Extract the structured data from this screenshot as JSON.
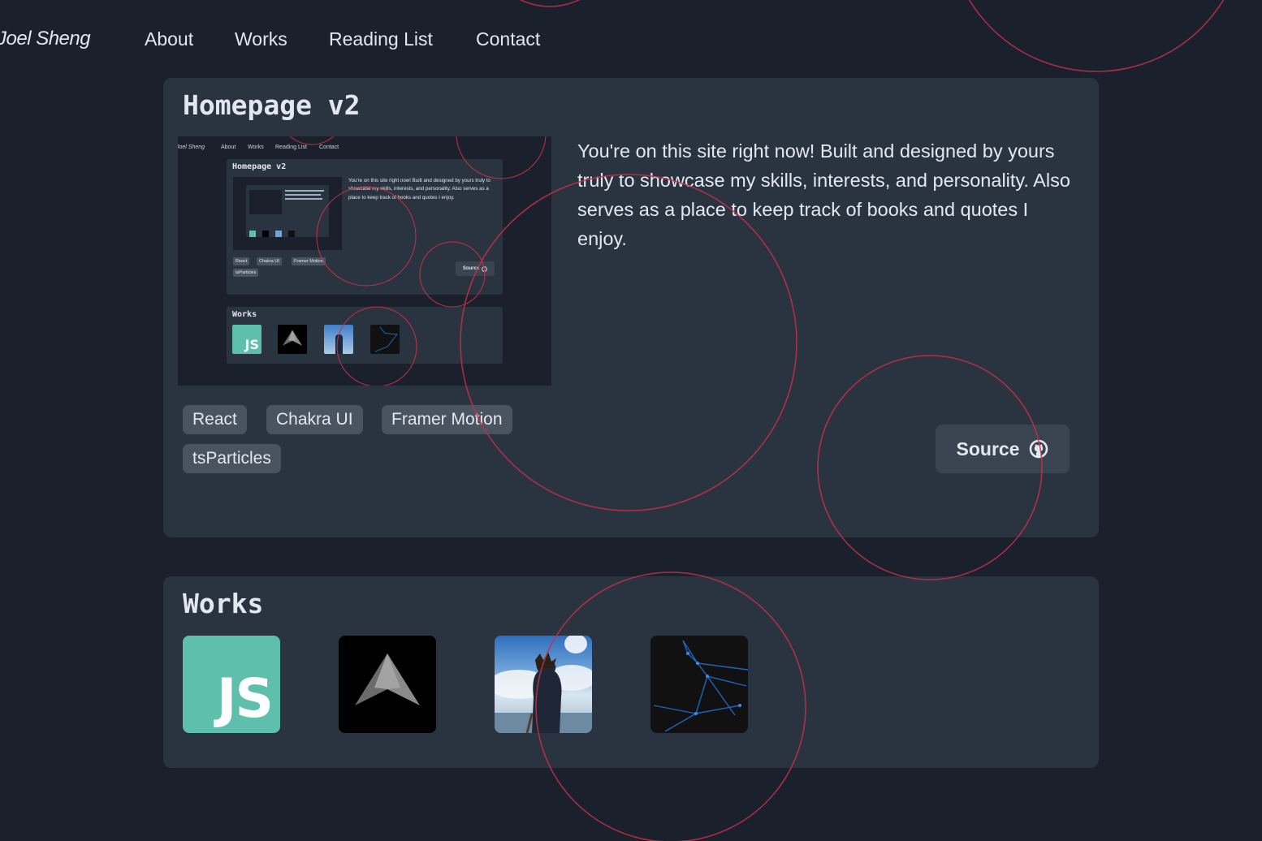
{
  "nav": {
    "logo": "Joel Sheng",
    "links": [
      "About",
      "Works",
      "Reading List",
      "Contact"
    ]
  },
  "project": {
    "title": "Homepage v2",
    "description": "You're on this site right now! Built and designed by yours truly to showcase my skills, interests, and personality. Also serves as a place to keep track of books and quotes I enjoy.",
    "tags": [
      "React",
      "Chakra UI",
      "Framer Motion",
      "tsParticles"
    ],
    "source_label": "Source",
    "source_icon": "github-icon"
  },
  "works": {
    "title": "Works",
    "items": [
      {
        "name": "js-work-thumbnail",
        "label": "JS",
        "color": "#5fbfad"
      },
      {
        "name": "paper-plane-work-thumbnail",
        "color": "#000000"
      },
      {
        "name": "anime-sky-work-thumbnail",
        "color": "#6fa3d9"
      },
      {
        "name": "network-particles-work-thumbnail",
        "color": "#111111"
      }
    ]
  },
  "colors": {
    "background": "#1a202c",
    "card": "#2a3340",
    "tag": "#4a5360",
    "particle_ring": "#c53048",
    "js_green": "#5fbfad"
  }
}
